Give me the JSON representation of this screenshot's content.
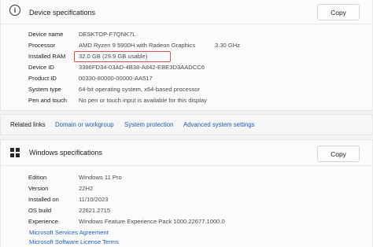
{
  "device": {
    "title": "Device specifications",
    "copy_label": "Copy",
    "rows": [
      {
        "label": "Device name",
        "value": "DESKTOP-F7QNK7L",
        "extra": ""
      },
      {
        "label": "Processor",
        "value": "AMD Ryzen 9 5900H with Radeon Graphics",
        "extra": "3.30 GHz"
      },
      {
        "label": "Installed RAM",
        "value": "32.0 GB (29.9 GB usable)",
        "extra": ""
      },
      {
        "label": "Device ID",
        "value": "3386FD34-03AD-4B38-A842-EBE3D3AADCC6",
        "extra": ""
      },
      {
        "label": "Product ID",
        "value": "00330-80000-00000-AA517",
        "extra": ""
      },
      {
        "label": "System type",
        "value": "64-bit operating system, x64-based processor",
        "extra": ""
      },
      {
        "label": "Pen and touch",
        "value": "No pen or touch input is available for this display",
        "extra": ""
      }
    ]
  },
  "related": {
    "label": "Related links",
    "links": [
      "Domain or workgroup",
      "System protection",
      "Advanced system settings"
    ]
  },
  "windows": {
    "title": "Windows specifications",
    "copy_label": "Copy",
    "rows": [
      {
        "label": "Edition",
        "value": "Windows 11 Pro"
      },
      {
        "label": "Version",
        "value": "22H2"
      },
      {
        "label": "Installed on",
        "value": "11/10/2023"
      },
      {
        "label": "OS build",
        "value": "22621.2715"
      },
      {
        "label": "Experience",
        "value": "Windows Feature Experience Pack 1000.22677.1000.0"
      }
    ],
    "links": [
      "Microsoft Services Agreement",
      "Microsoft Software License Terms"
    ]
  },
  "colors": {
    "highlight": "#d9534f",
    "link": "#1a5fb4"
  }
}
